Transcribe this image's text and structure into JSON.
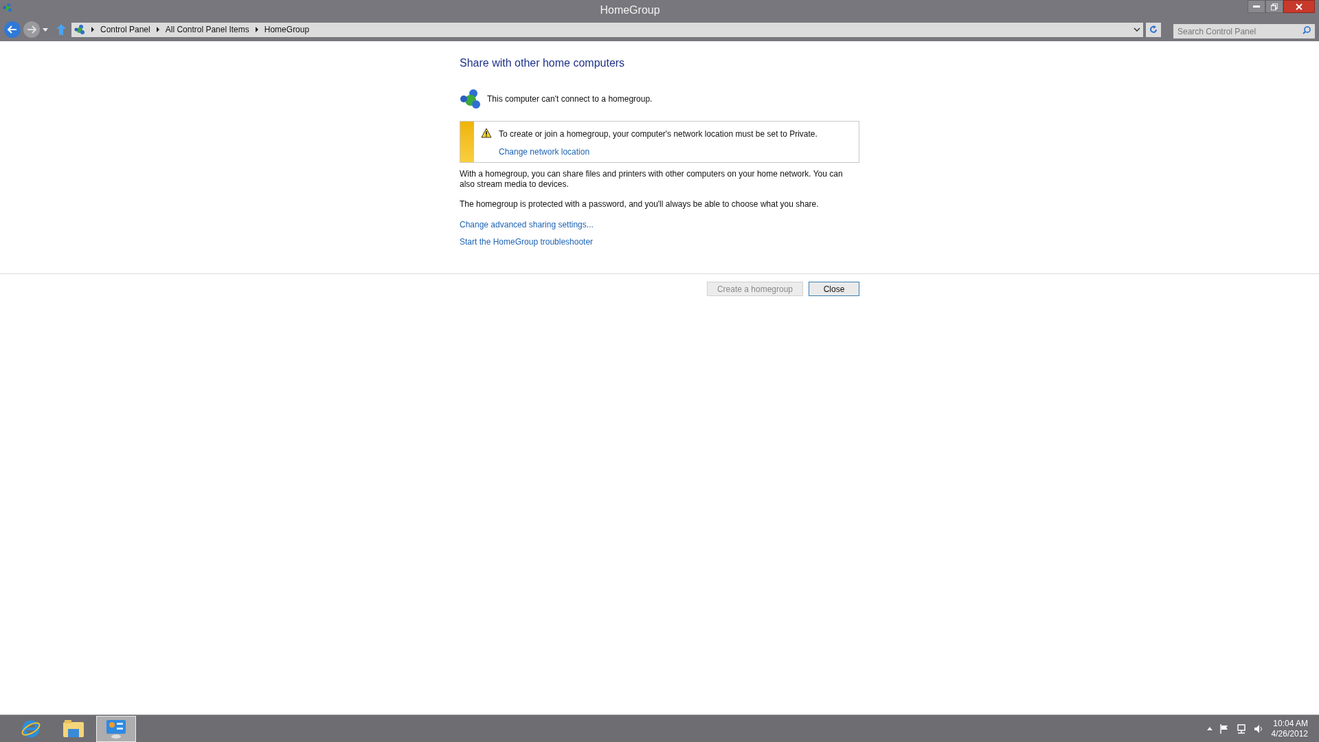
{
  "window": {
    "title": "HomeGroup"
  },
  "address_bar": {
    "breadcrumbs": [
      "Control Panel",
      "All Control Panel Items",
      "HomeGroup"
    ]
  },
  "search": {
    "placeholder": "Search Control Panel"
  },
  "heading": "Share with other home computers",
  "status": "This computer can't connect to a homegroup.",
  "warning": {
    "message": "To create or join a homegroup, your computer's network location must be set to Private.",
    "link": "Change network location"
  },
  "paragraphs": [
    "With a homegroup, you can share files and printers with other computers on your home network. You can also stream media to devices.",
    "The homegroup is protected with a password, and you'll always be able to choose what you share."
  ],
  "links": [
    "Change advanced sharing settings...",
    "Start the HomeGroup troubleshooter"
  ],
  "buttons": [
    {
      "label": "Create a homegroup",
      "disabled": true
    },
    {
      "label": "Close",
      "disabled": false
    }
  ],
  "taskbar": {
    "apps": [
      {
        "kind": "browser",
        "selected": false
      },
      {
        "kind": "explorer",
        "selected": false
      },
      {
        "kind": "control-panel",
        "selected": true
      }
    ],
    "clock": {
      "time": "10:04 AM",
      "date": "4/26/2012"
    }
  }
}
